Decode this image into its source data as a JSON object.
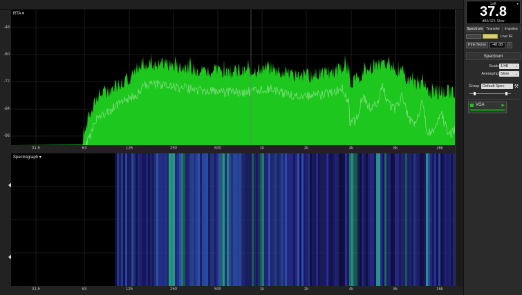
{
  "meter": {
    "channel": "Left",
    "value": "37.8",
    "unit": "dBA SPL Slow"
  },
  "modes": [
    "Spectrum",
    "Transfer",
    "Impulse"
  ],
  "live_ir_label": "Live IR",
  "pink_noise": {
    "label": "Pink Noise",
    "level": "-48 dB"
  },
  "panel": {
    "title": "Spectrum",
    "scale_label": "Scale",
    "scale_value": "1/48",
    "averaging_label": "Averaging",
    "averaging_value": "Slow",
    "group_label": "Group",
    "group_value": "Default Spec"
  },
  "measurement": {
    "name": "VGA",
    "color": "#1ec71e"
  },
  "rta": {
    "title": "RTA ▾",
    "y_ticks": [
      "-48",
      "-60",
      "-72",
      "-84",
      "-96"
    ],
    "x_ticks": [
      "31.5",
      "63",
      "125",
      "250",
      "500",
      "1k",
      "2k",
      "4k",
      "8k",
      "16k"
    ]
  },
  "spectrograph": {
    "title": "Spectrograph ▾",
    "x_ticks": [
      "31.5",
      "63",
      "125",
      "250",
      "500",
      "1k",
      "2k",
      "4k",
      "8k",
      "16k"
    ]
  },
  "colors": {
    "trace_fill": "#1ec71e",
    "trace_line": "#7ae07a",
    "spectrograph_base": "#1a1a6a"
  }
}
